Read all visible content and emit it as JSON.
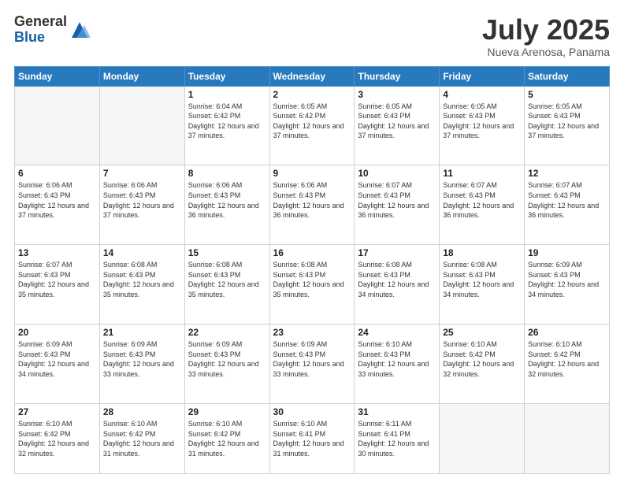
{
  "logo": {
    "general": "General",
    "blue": "Blue"
  },
  "header": {
    "month": "July 2025",
    "location": "Nueva Arenosa, Panama"
  },
  "weekdays": [
    "Sunday",
    "Monday",
    "Tuesday",
    "Wednesday",
    "Thursday",
    "Friday",
    "Saturday"
  ],
  "weeks": [
    [
      {
        "day": "",
        "info": ""
      },
      {
        "day": "",
        "info": ""
      },
      {
        "day": "1",
        "info": "Sunrise: 6:04 AM\nSunset: 6:42 PM\nDaylight: 12 hours and 37 minutes."
      },
      {
        "day": "2",
        "info": "Sunrise: 6:05 AM\nSunset: 6:42 PM\nDaylight: 12 hours and 37 minutes."
      },
      {
        "day": "3",
        "info": "Sunrise: 6:05 AM\nSunset: 6:43 PM\nDaylight: 12 hours and 37 minutes."
      },
      {
        "day": "4",
        "info": "Sunrise: 6:05 AM\nSunset: 6:43 PM\nDaylight: 12 hours and 37 minutes."
      },
      {
        "day": "5",
        "info": "Sunrise: 6:05 AM\nSunset: 6:43 PM\nDaylight: 12 hours and 37 minutes."
      }
    ],
    [
      {
        "day": "6",
        "info": "Sunrise: 6:06 AM\nSunset: 6:43 PM\nDaylight: 12 hours and 37 minutes."
      },
      {
        "day": "7",
        "info": "Sunrise: 6:06 AM\nSunset: 6:43 PM\nDaylight: 12 hours and 37 minutes."
      },
      {
        "day": "8",
        "info": "Sunrise: 6:06 AM\nSunset: 6:43 PM\nDaylight: 12 hours and 36 minutes."
      },
      {
        "day": "9",
        "info": "Sunrise: 6:06 AM\nSunset: 6:43 PM\nDaylight: 12 hours and 36 minutes."
      },
      {
        "day": "10",
        "info": "Sunrise: 6:07 AM\nSunset: 6:43 PM\nDaylight: 12 hours and 36 minutes."
      },
      {
        "day": "11",
        "info": "Sunrise: 6:07 AM\nSunset: 6:43 PM\nDaylight: 12 hours and 36 minutes."
      },
      {
        "day": "12",
        "info": "Sunrise: 6:07 AM\nSunset: 6:43 PM\nDaylight: 12 hours and 36 minutes."
      }
    ],
    [
      {
        "day": "13",
        "info": "Sunrise: 6:07 AM\nSunset: 6:43 PM\nDaylight: 12 hours and 35 minutes."
      },
      {
        "day": "14",
        "info": "Sunrise: 6:08 AM\nSunset: 6:43 PM\nDaylight: 12 hours and 35 minutes."
      },
      {
        "day": "15",
        "info": "Sunrise: 6:08 AM\nSunset: 6:43 PM\nDaylight: 12 hours and 35 minutes."
      },
      {
        "day": "16",
        "info": "Sunrise: 6:08 AM\nSunset: 6:43 PM\nDaylight: 12 hours and 35 minutes."
      },
      {
        "day": "17",
        "info": "Sunrise: 6:08 AM\nSunset: 6:43 PM\nDaylight: 12 hours and 34 minutes."
      },
      {
        "day": "18",
        "info": "Sunrise: 6:08 AM\nSunset: 6:43 PM\nDaylight: 12 hours and 34 minutes."
      },
      {
        "day": "19",
        "info": "Sunrise: 6:09 AM\nSunset: 6:43 PM\nDaylight: 12 hours and 34 minutes."
      }
    ],
    [
      {
        "day": "20",
        "info": "Sunrise: 6:09 AM\nSunset: 6:43 PM\nDaylight: 12 hours and 34 minutes."
      },
      {
        "day": "21",
        "info": "Sunrise: 6:09 AM\nSunset: 6:43 PM\nDaylight: 12 hours and 33 minutes."
      },
      {
        "day": "22",
        "info": "Sunrise: 6:09 AM\nSunset: 6:43 PM\nDaylight: 12 hours and 33 minutes."
      },
      {
        "day": "23",
        "info": "Sunrise: 6:09 AM\nSunset: 6:43 PM\nDaylight: 12 hours and 33 minutes."
      },
      {
        "day": "24",
        "info": "Sunrise: 6:10 AM\nSunset: 6:43 PM\nDaylight: 12 hours and 33 minutes."
      },
      {
        "day": "25",
        "info": "Sunrise: 6:10 AM\nSunset: 6:42 PM\nDaylight: 12 hours and 32 minutes."
      },
      {
        "day": "26",
        "info": "Sunrise: 6:10 AM\nSunset: 6:42 PM\nDaylight: 12 hours and 32 minutes."
      }
    ],
    [
      {
        "day": "27",
        "info": "Sunrise: 6:10 AM\nSunset: 6:42 PM\nDaylight: 12 hours and 32 minutes."
      },
      {
        "day": "28",
        "info": "Sunrise: 6:10 AM\nSunset: 6:42 PM\nDaylight: 12 hours and 31 minutes."
      },
      {
        "day": "29",
        "info": "Sunrise: 6:10 AM\nSunset: 6:42 PM\nDaylight: 12 hours and 31 minutes."
      },
      {
        "day": "30",
        "info": "Sunrise: 6:10 AM\nSunset: 6:41 PM\nDaylight: 12 hours and 31 minutes."
      },
      {
        "day": "31",
        "info": "Sunrise: 6:11 AM\nSunset: 6:41 PM\nDaylight: 12 hours and 30 minutes."
      },
      {
        "day": "",
        "info": ""
      },
      {
        "day": "",
        "info": ""
      }
    ]
  ]
}
